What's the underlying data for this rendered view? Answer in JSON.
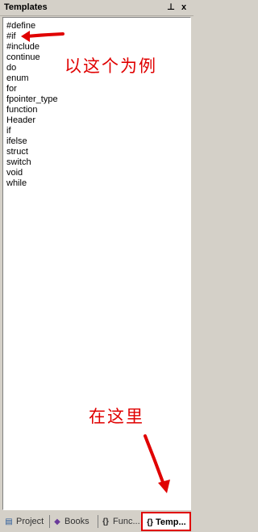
{
  "window": {
    "title": "Templates",
    "pin_glyph": "⊥",
    "close_glyph": "x"
  },
  "templates": [
    "#define",
    "#if",
    "#include",
    "continue",
    "do",
    "enum",
    "for",
    "fpointer_type",
    "function",
    "Header",
    "if",
    "ifelse",
    "struct",
    "switch",
    "void",
    "while"
  ],
  "annotations": {
    "example": "以这个为例",
    "here": "在这里",
    "color": "#e00000"
  },
  "tabs": [
    {
      "label": "Project",
      "icon": "project-icon"
    },
    {
      "label": "Books",
      "icon": "books-icon"
    },
    {
      "label": "Func...",
      "icon": "braces-icon"
    },
    {
      "label": "Temp...",
      "icon": "template-icon",
      "active": true
    }
  ]
}
